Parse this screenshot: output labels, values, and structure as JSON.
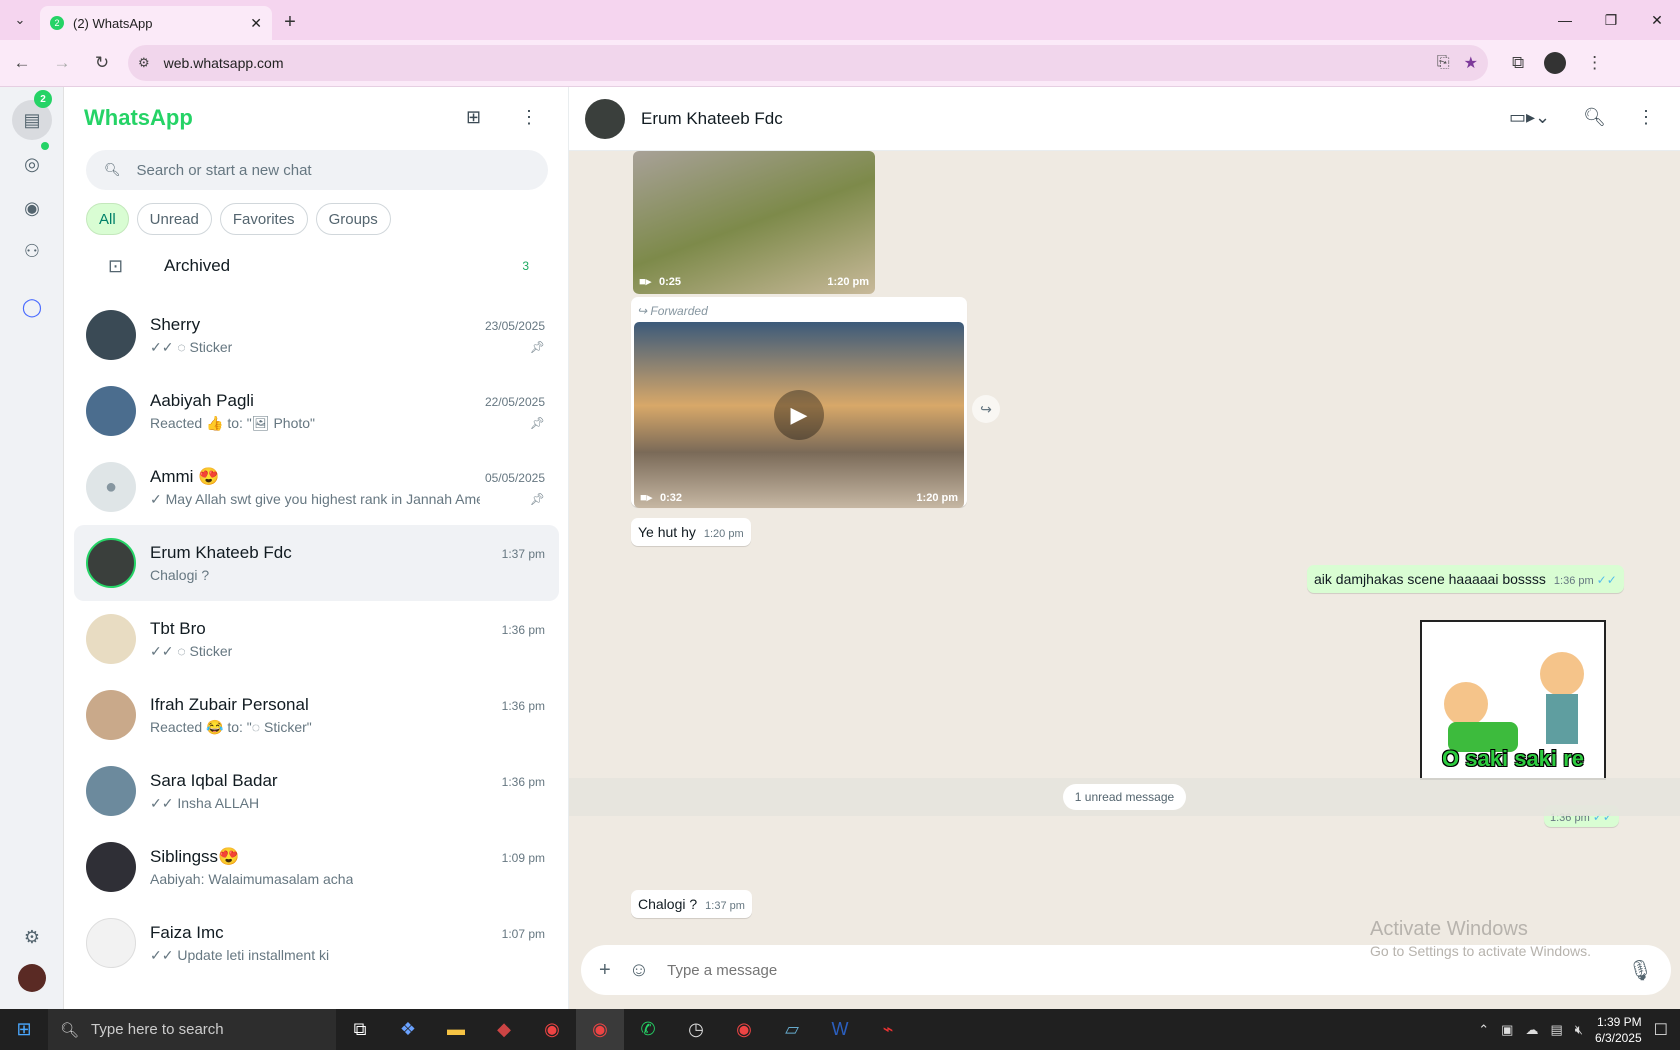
{
  "browser": {
    "tab_title": "(2) WhatsApp",
    "tab_badge": "2",
    "url": "web.whatsapp.com"
  },
  "rail": {
    "chats_badge": "2"
  },
  "sidebar": {
    "title": "WhatsApp",
    "search_placeholder": "Search or start a new chat",
    "filters": [
      "All",
      "Unread",
      "Favorites",
      "Groups"
    ],
    "archived_label": "Archived",
    "archived_count": "3",
    "chats": [
      {
        "name": "Sherry",
        "time": "23/05/2025",
        "preview": "✓✓ ◌ Sticker",
        "pinned": true,
        "avatar_color": "#3a4a55"
      },
      {
        "name": "Aabiyah Pagli",
        "time": "22/05/2025",
        "preview": "Reacted 👍 to: \"🖼 Photo\"",
        "pinned": true,
        "avatar_color": "#4b6d8e"
      },
      {
        "name": "Ammi 😍",
        "time": "05/05/2025",
        "preview": "✓ May Allah swt give you highest rank in Jannah  Ame...",
        "pinned": true,
        "avatar_color": "#dfe5e7"
      },
      {
        "name": "Erum Khateeb Fdc",
        "time": "1:37 pm",
        "preview": "Chalogi ?",
        "pinned": false,
        "avatar_color": "#3a3f3c"
      },
      {
        "name": "Tbt Bro",
        "time": "1:36 pm",
        "preview": "✓✓ ◌ Sticker",
        "pinned": false,
        "avatar_color": "#e8dcc2"
      },
      {
        "name": "Ifrah Zubair Personal",
        "time": "1:36 pm",
        "preview": "Reacted 😂 to: \"◌ Sticker\"",
        "pinned": false,
        "avatar_color": "#c9a98a"
      },
      {
        "name": "Sara Iqbal Badar",
        "time": "1:36 pm",
        "preview": "✓✓ Insha ALLAH",
        "pinned": false,
        "avatar_color": "#6c8a9d"
      },
      {
        "name": "Siblingss😍",
        "time": "1:09 pm",
        "preview": "Aabiyah: Walaimumasalam acha",
        "pinned": false,
        "avatar_color": "#2f2f36"
      },
      {
        "name": "Faiza Imc",
        "time": "1:07 pm",
        "preview": "✓✓ Update leti installment ki",
        "pinned": false,
        "avatar_color": "#f2f2f2"
      }
    ]
  },
  "conversation": {
    "contact_name": "Erum Khateeb Fdc",
    "video1_duration": "0:25",
    "video1_time": "1:20 pm",
    "forwarded_label": "Forwarded",
    "video2_duration": "0:32",
    "video2_time": "1:20 pm",
    "msg1_text": "Ye hut hy",
    "msg1_time": "1:20 pm",
    "out1_text": "aik damjhakas scene haaaaai bossss",
    "out1_time": "1:36 pm",
    "sticker_text": "O saki saki re",
    "sticker_time": "1:36 pm",
    "unread_divider": "1 unread message",
    "msg2_text": "Chalogi ?",
    "msg2_time": "1:37 pm",
    "composer_placeholder": "Type a message"
  },
  "windows": {
    "watermark_title": "Activate Windows",
    "watermark_sub": "Go to Settings to activate Windows.",
    "search_placeholder": "Type here to search",
    "time": "1:39 PM",
    "date": "6/3/2025"
  }
}
